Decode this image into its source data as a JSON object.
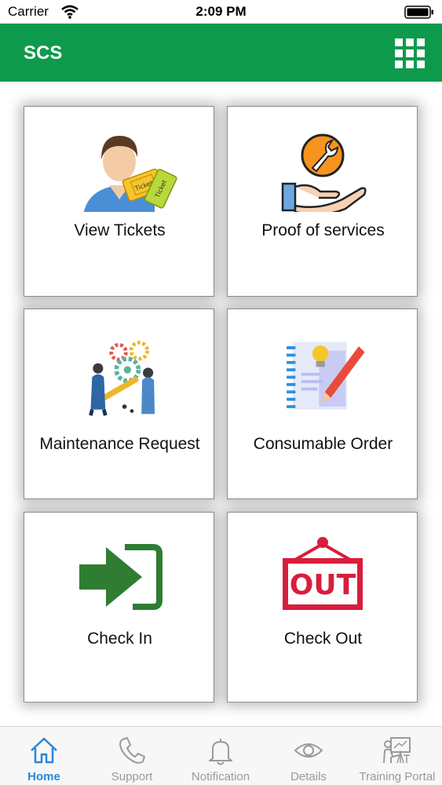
{
  "status_bar": {
    "carrier": "Carrier",
    "time": "2:09 PM"
  },
  "header": {
    "title": "SCS"
  },
  "tiles": [
    {
      "label": "View Tickets",
      "icon": "ticket-user-icon"
    },
    {
      "label": "Proof of services",
      "icon": "service-hand-wrench-icon"
    },
    {
      "label": "Maintenance Request",
      "icon": "maintenance-gears-icon"
    },
    {
      "label": "Consumable Order",
      "icon": "notebook-pencil-icon"
    },
    {
      "label": "Check In",
      "icon": "check-in-arrow-icon"
    },
    {
      "label": "Check Out",
      "icon": "out-sign-icon"
    }
  ],
  "tab_bar": {
    "tabs": [
      {
        "label": "Home",
        "icon": "home-icon",
        "active": true
      },
      {
        "label": "Support",
        "icon": "phone-icon",
        "active": false
      },
      {
        "label": "Notification",
        "icon": "bell-icon",
        "active": false
      },
      {
        "label": "Details",
        "icon": "eye-icon",
        "active": false
      },
      {
        "label": "Training Portal",
        "icon": "training-board-icon",
        "active": false
      }
    ]
  },
  "colors": {
    "header": "#0e9a4c",
    "active_tab": "#2a86d8",
    "inactive_tab": "#9a9a9a",
    "check_in": "#2e7d32",
    "check_out": "#d81e3c"
  }
}
